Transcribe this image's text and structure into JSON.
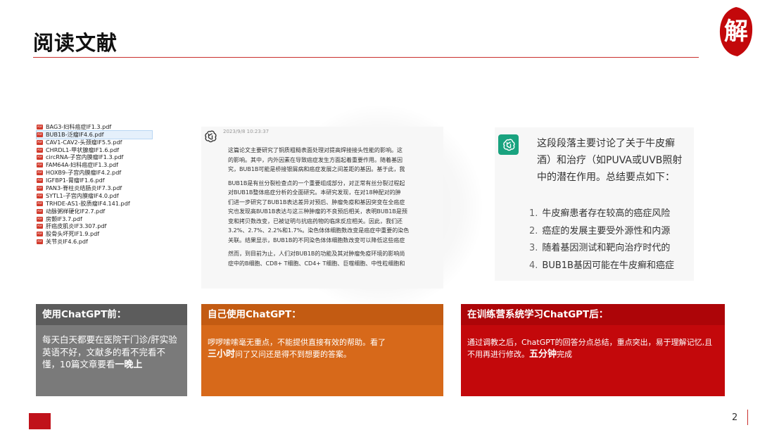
{
  "slide": {
    "title": "阅读文献",
    "page_number": "2",
    "seal_text": "解",
    "colors": {
      "accent_red": "#c9302c",
      "grey": "#7a7a7a",
      "orange": "#d7691a",
      "red": "#c3080b"
    }
  },
  "file_list": {
    "selected_index": 1,
    "icon": "pdf-icon",
    "files": [
      "BAG3-妇科癌症IF1.3.pdf",
      "BUB1B-泛瘤IF4.6.pdf",
      "CAV1-CAV2-头颈瘤IF5.5.pdf",
      "CHRDL1-甲状腺瘤IF1.6.pdf",
      "circRNA-子宫内膜瘤IF1.3.pdf",
      "FAM64A-妇科癌症IF1.3.pdf",
      "HOXB9-子宫内膜瘤IF4.2.pdf",
      "IGFBP1-胃瘤IF1.6.pdf",
      "PAN3-脊柱炎结肠炎IF7.3.pdf",
      "SYTL1-子宫内膜瘤IF4.0.pdf",
      "TRHDE-AS1-胶质瘤IF4.141.pdf",
      "动脉粥样硬化IF2.7.pdf",
      "房颤IF3.7.pdf",
      "肝癌皮肌炎IF3.307.pdf",
      "股骨头坏死IF1.9.pdf",
      "关节炎IF4.6.pdf"
    ]
  },
  "chat_panel": {
    "timestamp": "2023/9/8 10:23:37",
    "paragraphs": [
      [
        "这篇论文主要研究了铜质粗糙表面处理对提高焊接接头性能的影响。这",
        "的影响。其中，内外因素在导致癌症发生方面起着重要作用。随着基因",
        "究，BUB1B可能是桥接银屑病和癌症发展之间差距的基因。基于此，我"
      ],
      [
        "BUB1B是有丝分裂检查点的一个重要组成部分，对正常有丝分裂过程起",
        "对BUB1B整体癌症分析的全面研究。本研究发现，在对18种配对的肿",
        "们进一步研究了BUB1B表达差异对预后、肿瘤免疫和基因突变在全癌症",
        "究也发现高BUB1B表达与这三种肿瘤的不良预后相关，表明BUB1B是预",
        "变和拷贝数改变，已被证明与抗癌药物的临床反应相关。因此，我们还",
        "3.2%、2.7%、2.2%和1.7%。染色体体细胞数改变是癌症中重要的染色",
        "关联。结果显示，BUB1B的不同染色体体细胞数改变可以降低这些癌症"
      ],
      [
        "然而，到目前为止，人们对BUB1B的功能及其对肿瘤免疫环境的影响尚",
        "症中的B细胞、CD8+ T细胞、CD4+ T细胞、巨噬细胞、中性粒细胞和"
      ]
    ]
  },
  "summary_panel": {
    "logo": "chatgpt-logo-icon",
    "intro_lines": [
      "这段段落主要讨论了关于牛皮癣",
      "酒）和治疗（如PUVA或UVB照射",
      "中的潜在作用。总结要点如下："
    ],
    "points": [
      {
        "num": "1.",
        "text": "牛皮癣患者存在较高的癌症风险"
      },
      {
        "num": "2.",
        "text": "癌症的发展主要受外源性和内源"
      },
      {
        "num": "3.",
        "text": "随着基因测试和靶向治疗时代的"
      },
      {
        "num": "4.",
        "text": "BUB1B基因可能在牛皮癣和癌症"
      }
    ]
  },
  "cards": {
    "before": {
      "heading": "使用ChatGPT前：",
      "text": "每天白天都要在医院干门诊/肝实验英语不好，文献多的看不完看不懂，10篇文章要看",
      "emphasis": "一晚上"
    },
    "self": {
      "heading": "自己使用ChatGPT：",
      "text_before": "啰啰嗦嗦毫无重点，不能提供直接有效的帮助。看了",
      "emphasis": "三小时",
      "text_after": "问了又问还是得不到想要的答案。"
    },
    "after": {
      "heading": "在训练营系统学习ChatGPT后：",
      "text_before": "通过调教之后，ChatGPT的回答分点总结，重点突出，易于理解记忆,且不用再进行修改。",
      "emphasis": "五分钟",
      "text_after": "完成"
    }
  }
}
